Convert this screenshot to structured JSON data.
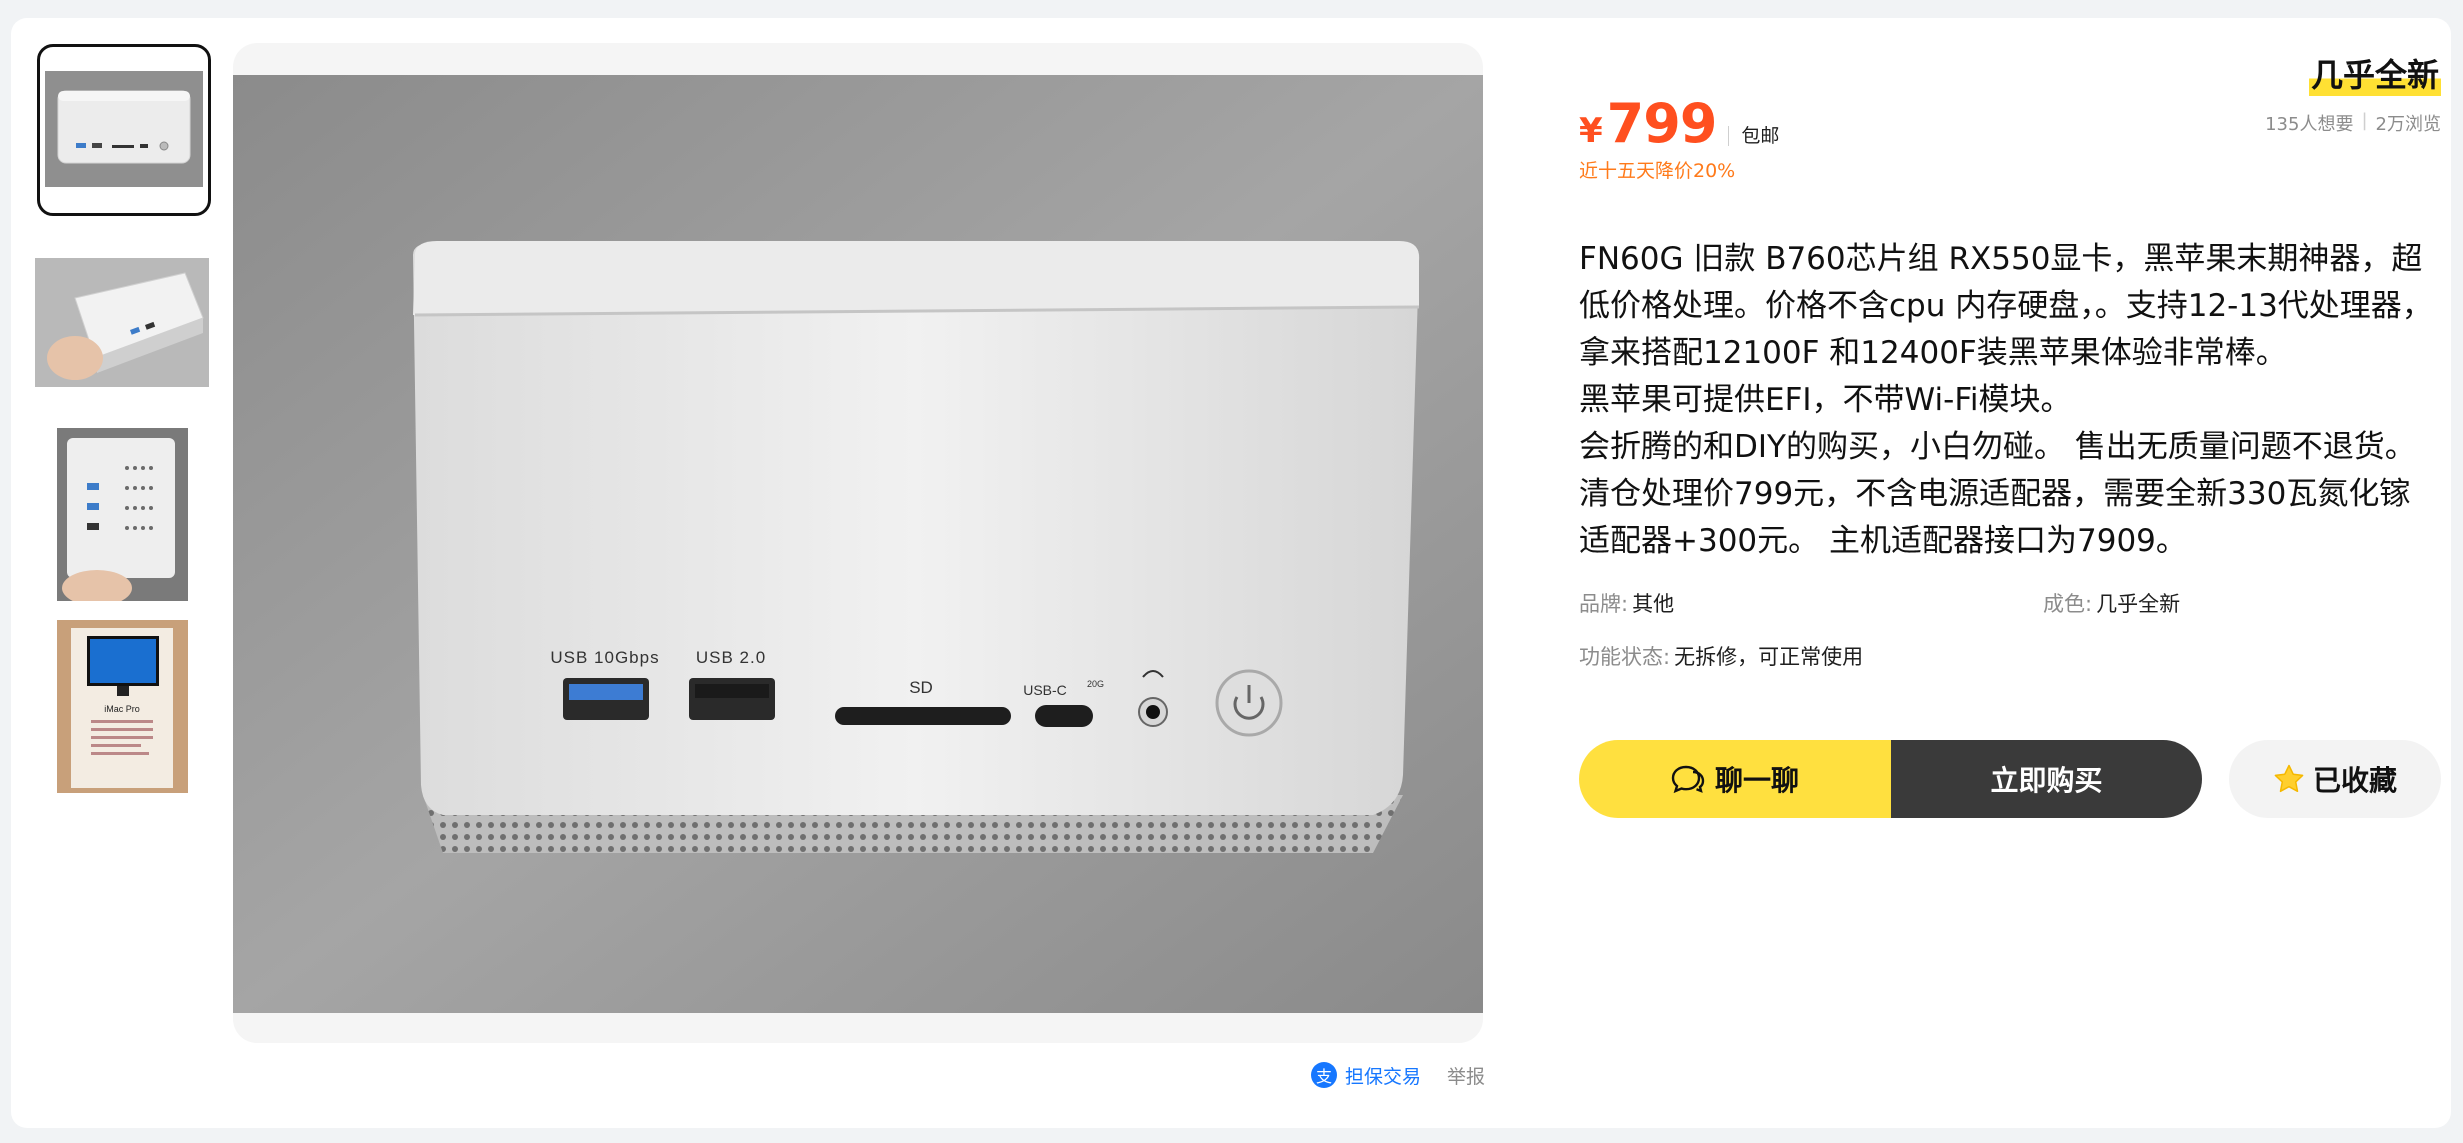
{
  "product": {
    "condition_title": "几乎全新",
    "currency_symbol": "¥",
    "price": "799",
    "shipping": "包邮",
    "price_drop": "近十五天降价20%",
    "stats": {
      "wants": "135人想要",
      "views": "2万浏览"
    },
    "description": [
      "FN60G 旧款 B760芯片组 RX550显卡，黑苹果末期神器，超低价格处理。价格不含cpu 内存硬盘，。支持12-13代处理器，拿来搭配12100F 和12400F装黑苹果体验非常棒。",
      "黑苹果可提供EFI，不带Wi-Fi模块。",
      "会折腾的和DIY的购买，小白勿碰。 售出无质量问题不退货。",
      "清仓处理价799元，不含电源适配器，需要全新330瓦氮化镓适配器+300元。 主机适配器接口为7909。"
    ],
    "properties": {
      "brand": {
        "label": "品牌:",
        "value": "其他"
      },
      "condition": {
        "label": "成色:",
        "value": "几乎全新"
      },
      "function_status": {
        "label": "功能状态:",
        "value": "无拆修，可正常使用"
      }
    }
  },
  "actions": {
    "chat_label": "聊一聊",
    "buy_label": "立即购买",
    "favorite_label": "已收藏"
  },
  "footer_links": {
    "guarantee_label": "担保交易",
    "guarantee_icon": "支",
    "report_label": "举报"
  },
  "image_labels": {
    "usb10": "USB 10Gbps",
    "usb2": "USB 2.0",
    "sd": "SD",
    "usbc": "USB-C",
    "usbc_sup": "20G",
    "imac_title": "iMac Pro"
  },
  "colors": {
    "price": "#ff4f1f",
    "drop_text": "#ff7a1a",
    "chat_button": "#ffe03f",
    "buy_button": "#3a3a3a",
    "guarantee_link": "#1677ff",
    "title_highlight": "#ffe033"
  },
  "icons": {
    "chat": "chat-bubble-icon",
    "favorite": "star-icon",
    "guarantee": "alipay-icon"
  }
}
